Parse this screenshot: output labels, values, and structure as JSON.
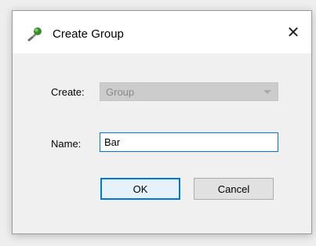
{
  "window": {
    "title": "Create Group",
    "close_glyph": "✕",
    "app_icon": "tool-icon"
  },
  "form": {
    "create_label": "Create:",
    "create_value": "Group",
    "create_disabled": true,
    "name_label": "Name:",
    "name_value": "Bar"
  },
  "buttons": {
    "ok_label": "OK",
    "cancel_label": "Cancel"
  },
  "colors": {
    "focus_accent": "#0078d7",
    "disabled_select_bg": "#cccccc",
    "disabled_text": "#8a8a8a"
  }
}
